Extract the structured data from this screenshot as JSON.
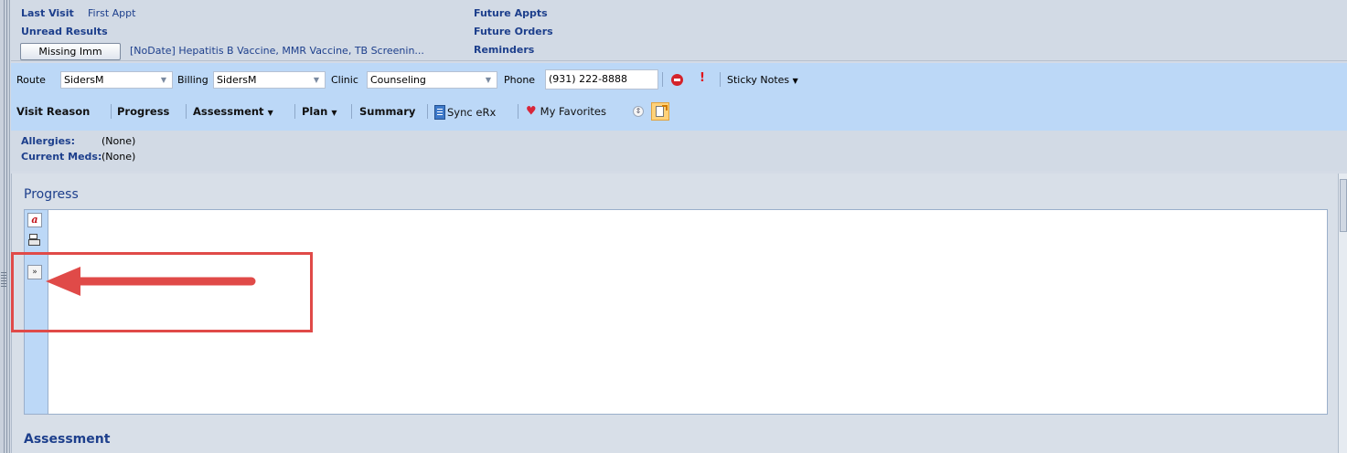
{
  "header": {
    "last_visit_label": "Last Visit",
    "last_visit_value": "First Appt",
    "unread_results_label": "Unread Results",
    "missing_imm_button": "Missing Imm",
    "missing_imm_text": "[NoDate] Hepatitis B Vaccine, MMR Vaccine, TB Screenin...",
    "future_appts": "Future Appts",
    "future_orders": "Future Orders",
    "reminders": "Reminders"
  },
  "toolbar": {
    "route_label": "Route",
    "route_value": "SidersM",
    "billing_label": "Billing",
    "billing_value": "SidersM",
    "clinic_label": "Clinic",
    "clinic_value": "Counseling",
    "phone_label": "Phone",
    "phone_value": "(931) 222-8888",
    "sticky_notes": "Sticky Notes"
  },
  "nav": {
    "visit_reason": "Visit Reason",
    "progress": "Progress",
    "assessment": "Assessment",
    "plan": "Plan",
    "summary": "Summary",
    "sync_erx": "Sync eRx",
    "my_favorites": "My Favorites"
  },
  "info": {
    "allergies_label": "Allergies:",
    "allergies_value": "(None)",
    "current_meds_label": "Current Meds:",
    "current_meds_value": "(None)"
  },
  "sections": {
    "progress_title": "Progress",
    "assessment_title": "Assessment"
  },
  "colors": {
    "accent_blue": "#1d3f8c",
    "toolbar_bg": "#bcd8f7",
    "annotation_red": "#e04a48"
  }
}
